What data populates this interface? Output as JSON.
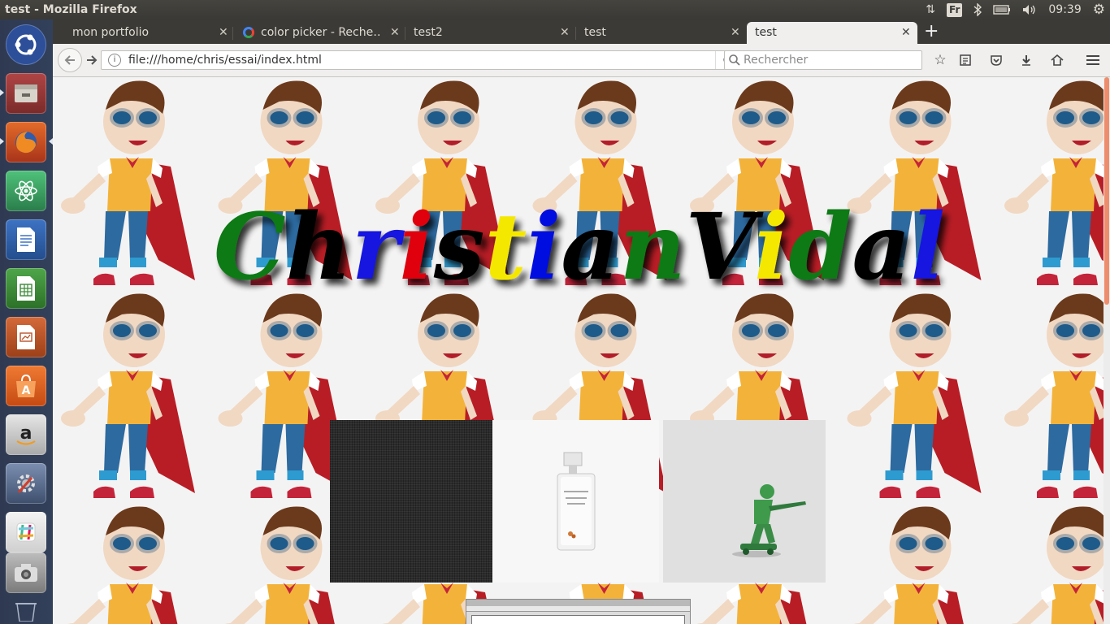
{
  "window": {
    "title": "test - Mozilla Firefox"
  },
  "tray": {
    "keyboard": "Fr",
    "clock": "09:39"
  },
  "launcher": {
    "items": [
      {
        "name": "ubuntu-dash-icon",
        "color": "#2a55b0"
      },
      {
        "name": "files-icon",
        "color": "#8a3a3a"
      },
      {
        "name": "firefox-icon",
        "color": "#c4451c"
      },
      {
        "name": "atom-icon",
        "color": "#3a9b5a"
      },
      {
        "name": "writer-icon",
        "color": "#2a5ea8"
      },
      {
        "name": "calc-icon",
        "color": "#3c8a38"
      },
      {
        "name": "impress-icon",
        "color": "#b8532a"
      },
      {
        "name": "software-center-icon",
        "color": "#d9591f"
      },
      {
        "name": "amazon-icon",
        "color": "#a0a0a0"
      },
      {
        "name": "settings-icon",
        "color": "#5a6f8f"
      },
      {
        "name": "slack-icon",
        "color": "#d0d0d0"
      },
      {
        "name": "camera-icon",
        "color": "#7a7a7a"
      },
      {
        "name": "trash-icon",
        "color": "#44506a"
      }
    ]
  },
  "tabs": [
    {
      "label": "mon portfolio",
      "active": false
    },
    {
      "label": "color picker - Reche…",
      "active": false
    },
    {
      "label": "test2",
      "active": false
    },
    {
      "label": "test",
      "active": false
    },
    {
      "label": "test",
      "active": true
    }
  ],
  "toolbar": {
    "url": "file:///home/chris/essai/index.html",
    "search_placeholder": "Rechercher"
  },
  "page": {
    "heading": "ChristianVidal",
    "heading_colors": [
      "#0a7a12",
      "#000000",
      "#1818e0",
      "#e00010",
      "#000000",
      "#f5e800",
      "#0008e0",
      "#000000",
      "#0a7a12",
      "#000000",
      "#f5e800"
    ],
    "background_character": "superhero-cartoon"
  }
}
